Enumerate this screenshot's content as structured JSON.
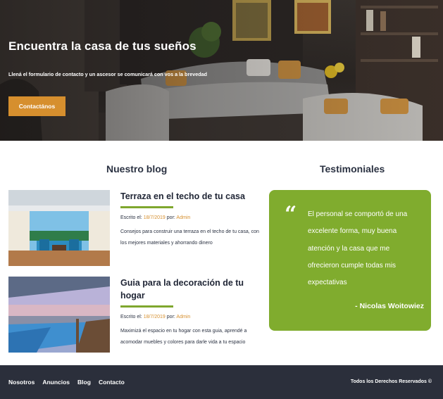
{
  "hero": {
    "title": "Encuentra la casa de tus sueños",
    "subtitle": "Llená el formulario de contacto y un ascesor se comunicará con vos a la brevedad",
    "cta_label": "Contactános"
  },
  "blog": {
    "heading": "Nuestro blog",
    "posts": [
      {
        "title": "Terraza en el techo de tu casa",
        "meta_prefix": "Escrito el: ",
        "date": "18/7/2019",
        "by_label": " por: ",
        "author": "Admin",
        "excerpt": "Consejos para construir una terraza en el techo de tu casa, con los mejores materiales y ahorrando dinero"
      },
      {
        "title": "Guia para la decoración de tu hogar",
        "meta_prefix": "Escrito el: ",
        "date": "18/7/2019",
        "by_label": " por: ",
        "author": "Admin",
        "excerpt": "Maximizá el espacio en tu hogar con esta guia, aprendé a acomodar muebles y colores para darle vida a tu espacio"
      }
    ]
  },
  "testimonials": {
    "heading": "Testimoniales",
    "quote_mark": "“",
    "text": "El personal se comportó de una excelente forma, muy buena atención y la casa que me ofrecieron cumple todas mis expectativas",
    "author": "- Nicolas Woitowiez"
  },
  "footer": {
    "links": [
      "Nosotros",
      "Anuncios",
      "Blog",
      "Contacto"
    ],
    "copyright": "Todos los Derechos Reservados ©"
  },
  "colors": {
    "accent_orange": "#d68f2e",
    "accent_green": "#80ac2e",
    "footer_bg": "#2b2f3b",
    "heading_text": "#2b3242"
  }
}
